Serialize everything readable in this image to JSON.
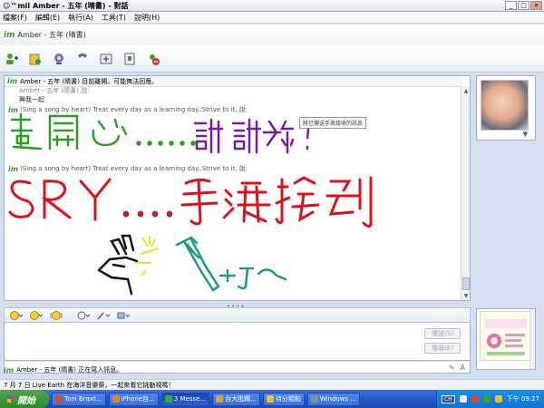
{
  "window": {
    "title": "☺™mil Amber - 五年 (晴書) - 對話"
  },
  "menu": [
    "檔案(F)",
    "編輯(E)",
    "執行(A)",
    "工具(T)",
    "說明(H)"
  ],
  "contact": {
    "logo": "im",
    "name": "Amber - 五年 (晴書)"
  },
  "toolbar": {
    "buttons": [
      "invite-icon",
      "send-file-icon",
      "webcam-icon",
      "phone-icon",
      "activities-icon",
      "games-icon",
      "block-icon"
    ]
  },
  "chat": {
    "status_line": "Amber - 五年 (晴書) 目前離開。可能無法回應。",
    "clipped_line": "Amber - 五年 (晴書) 說:",
    "message_1": "興我一起",
    "sender_1": "(Sing a song by heart) Treat every day as a learning day..Strive to it. 說:",
    "sender_2": "(Sing a song by heart) Treat every day as a learning day..Strive to it. 說:",
    "tooltip": "將已傳送手寫接收的訊息",
    "handwriting_lines": [
      "超開心……",
      "謝謝妳！",
      "SRY……手滑按到",
      "打〜"
    ]
  },
  "input_toolbar": [
    "emoticon-icon",
    "wink-icon",
    "nudge-icon",
    "font-icon",
    "pen-icon",
    "background-icon"
  ],
  "input": {
    "send_label": "傳送(S)",
    "search_label": "搜尋(E)"
  },
  "typing_status": "Amber - 五年 (晴書) 正在寫入訊息。",
  "status_bar": "7 月 7 日 Live Earth 在海洋音樂祭，一起來看它挑動視嗎！",
  "taskbar": {
    "start_label": "開始",
    "items": [
      {
        "label": "Toni Braxt...",
        "color": "#d84a2a"
      },
      {
        "label": "iPhone台...",
        "color": "#d88a2a"
      },
      {
        "label": "3 Messe...",
        "color": "#3aa84a"
      },
      {
        "label": "台大批踢...",
        "color": "#e0a030"
      },
      {
        "label": "待分類點",
        "color": "#f0c040"
      },
      {
        "label": "Windows ...",
        "color": "#8090a0"
      }
    ],
    "clock": "下午 09:27",
    "lang": "CH"
  },
  "colors": {
    "handwriting_green": "#2aa020",
    "handwriting_purple": "#7a1a9a",
    "handwriting_red": "#e0101a",
    "handwriting_teal": "#1a9a8a",
    "handwriting_yellow": "#f0e020"
  }
}
